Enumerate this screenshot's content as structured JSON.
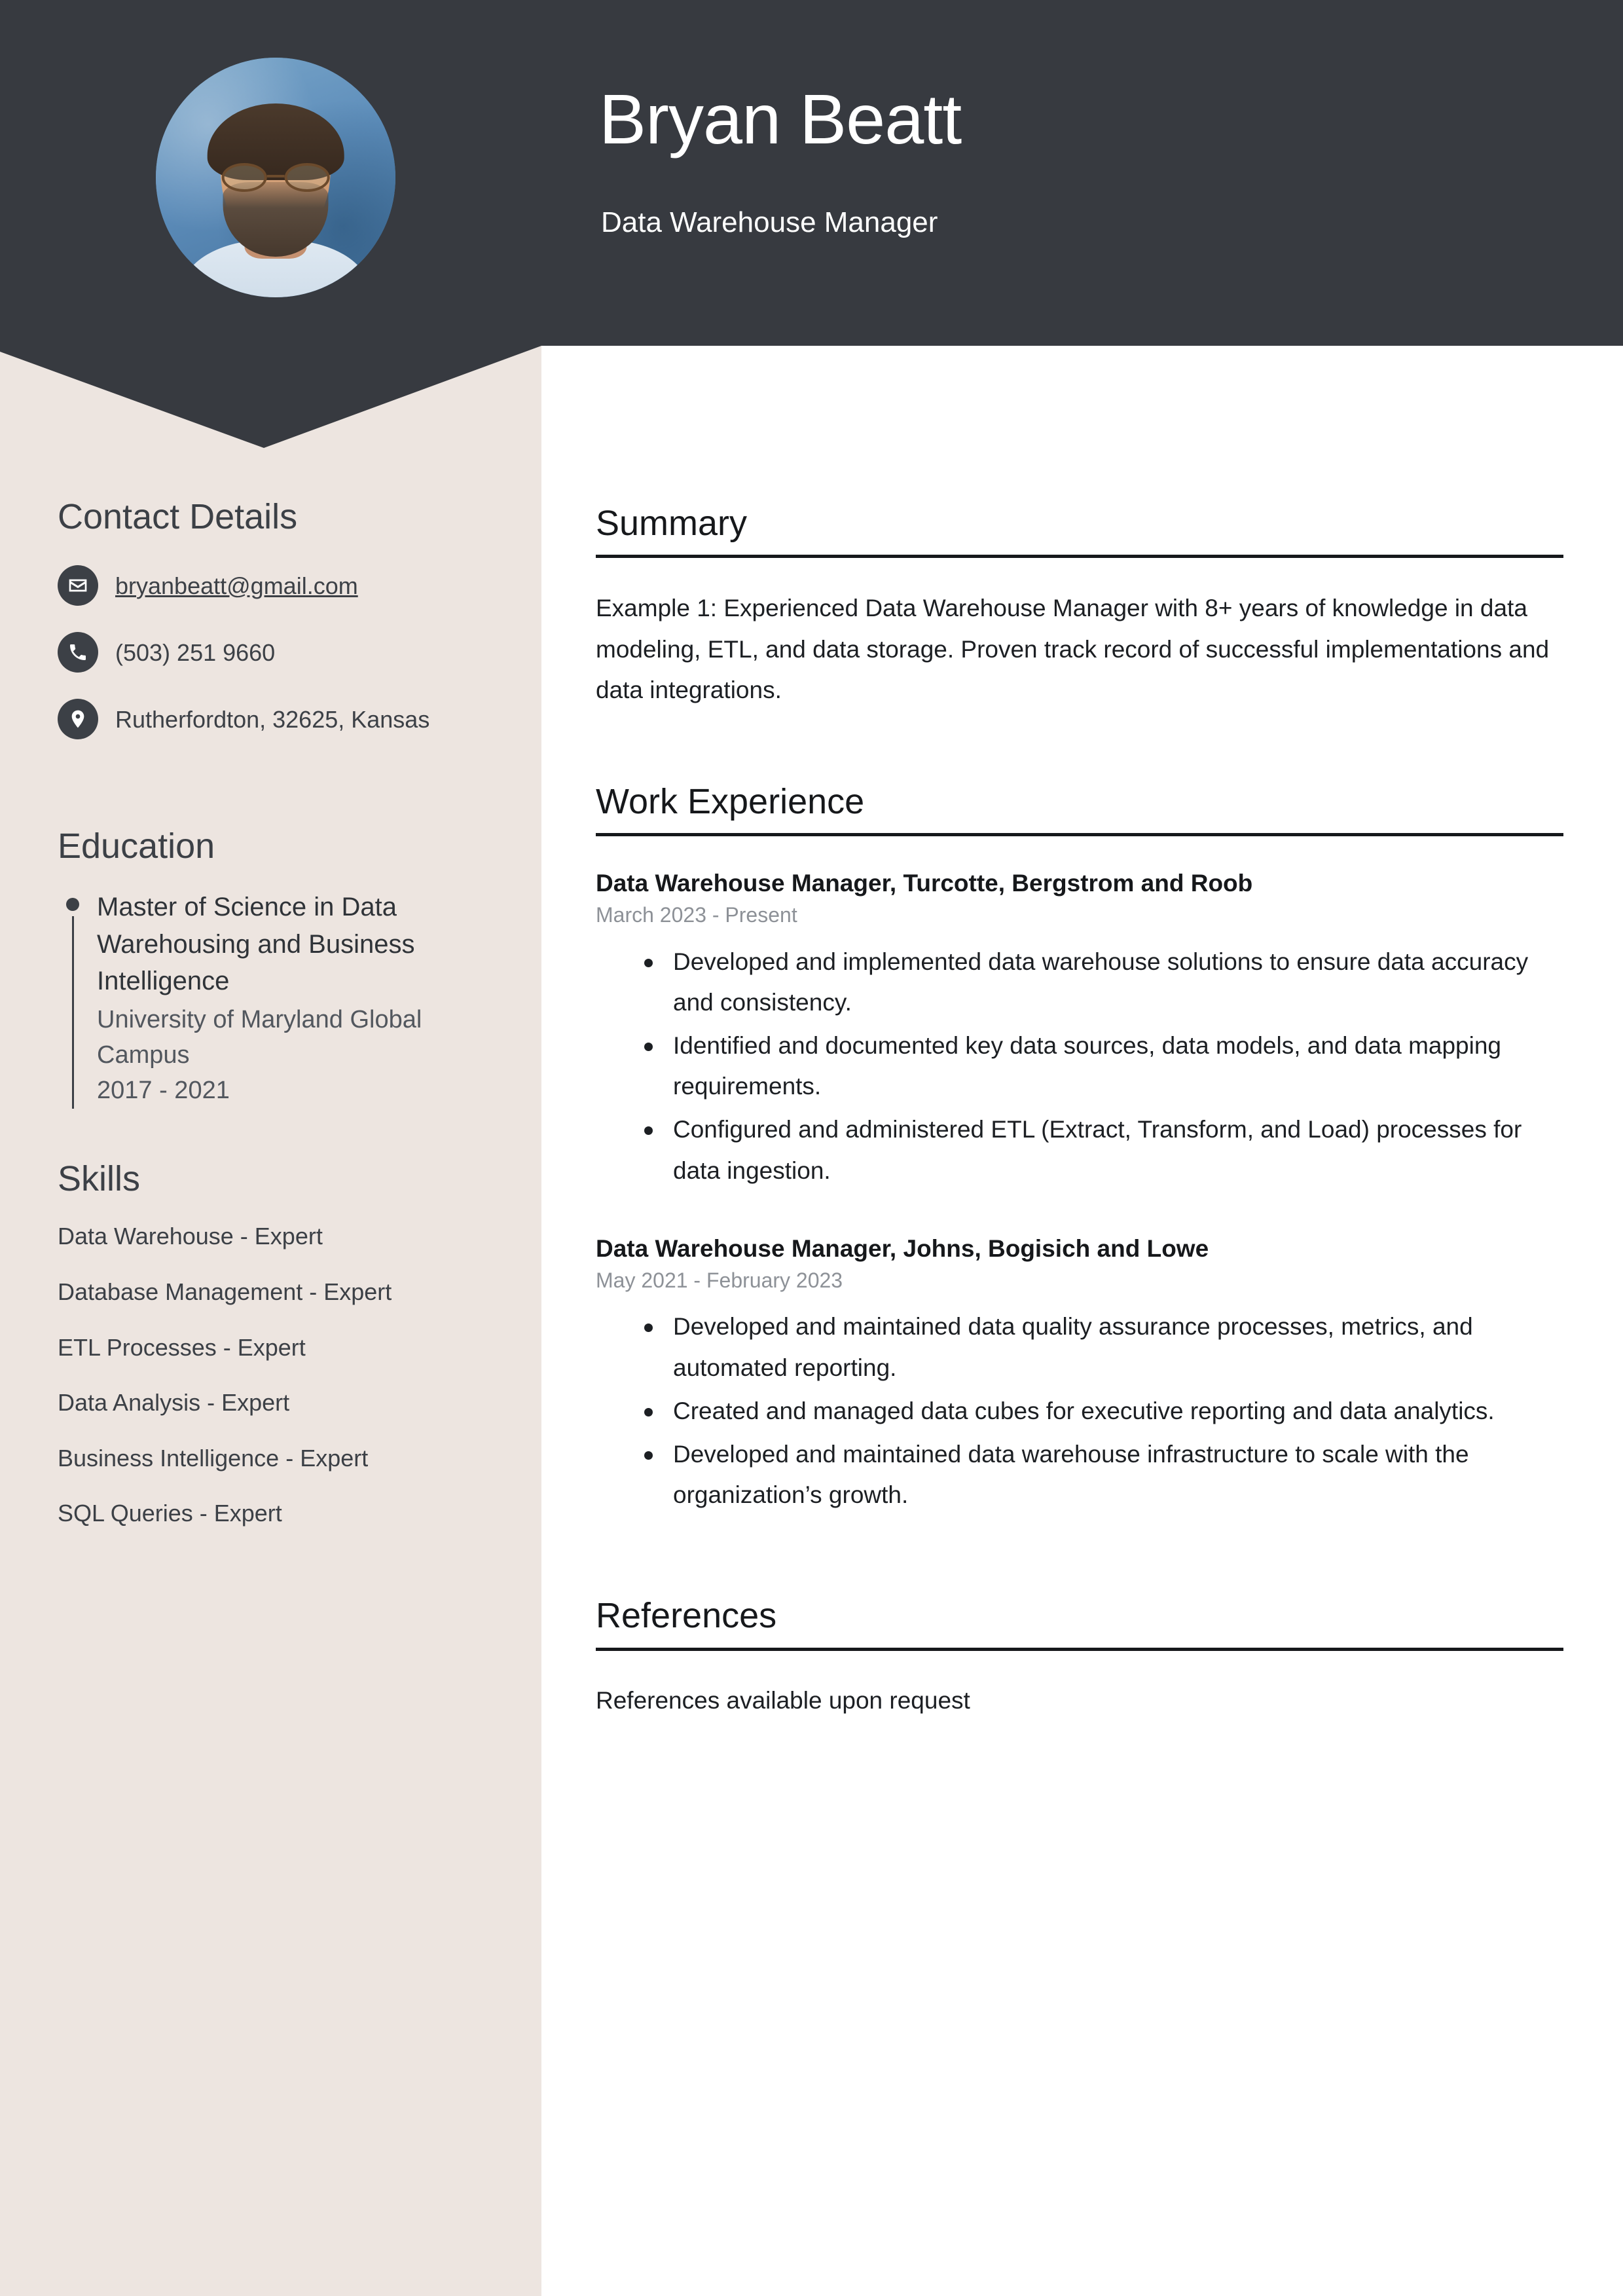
{
  "header": {
    "name": "Bryan Beatt",
    "job_title": "Data Warehouse Manager",
    "background_color": "#373a40",
    "avatar_alt": "profile-photo"
  },
  "sidebar": {
    "background_color": "#ede5e0",
    "contact": {
      "heading": "Contact Details",
      "items": [
        {
          "icon": "envelope-icon",
          "value": "bryanbeatt@gmail.com",
          "type": "email"
        },
        {
          "icon": "phone-icon",
          "value": "(503) 251 9660",
          "type": "phone"
        },
        {
          "icon": "location-pin-icon",
          "value": "Rutherfordton, 32625, Kansas",
          "type": "address"
        }
      ]
    },
    "education": {
      "heading": "Education",
      "entries": [
        {
          "degree": "Master of Science in Data Warehousing and Business Intelligence",
          "school": "University of Maryland Global Campus",
          "dates": "2017 - 2021"
        }
      ]
    },
    "skills": {
      "heading": "Skills",
      "items": [
        "Data Warehouse - Expert",
        "Database Management - Expert",
        "ETL Processes - Expert",
        "Data Analysis - Expert",
        "Business Intelligence - Expert",
        "SQL Queries - Expert"
      ]
    }
  },
  "main": {
    "summary": {
      "heading": "Summary",
      "text": "Example 1: Experienced Data Warehouse Manager with 8+ years of knowledge in data modeling, ETL, and data storage. Proven track record of successful implementations and data integrations."
    },
    "work_experience": {
      "heading": "Work Experience",
      "jobs": [
        {
          "title": "Data Warehouse Manager, Turcotte, Bergstrom and Roob",
          "dates": "March 2023 - Present",
          "bullets": [
            "Developed and implemented data warehouse solutions to ensure data accuracy and consistency.",
            "Identified and documented key data sources, data models, and data mapping requirements.",
            "Configured and administered ETL (Extract, Transform, and Load) processes for data ingestion."
          ]
        },
        {
          "title": "Data Warehouse Manager, Johns, Bogisich and Lowe",
          "dates": "May 2021 - February 2023",
          "bullets": [
            "Developed and maintained data quality assurance processes, metrics, and automated reporting.",
            "Created and managed data cubes for executive reporting and data analytics.",
            "Developed and maintained data warehouse infrastructure to scale with the organization’s growth."
          ]
        }
      ]
    },
    "references": {
      "heading": "References",
      "text": "References available upon request"
    }
  }
}
